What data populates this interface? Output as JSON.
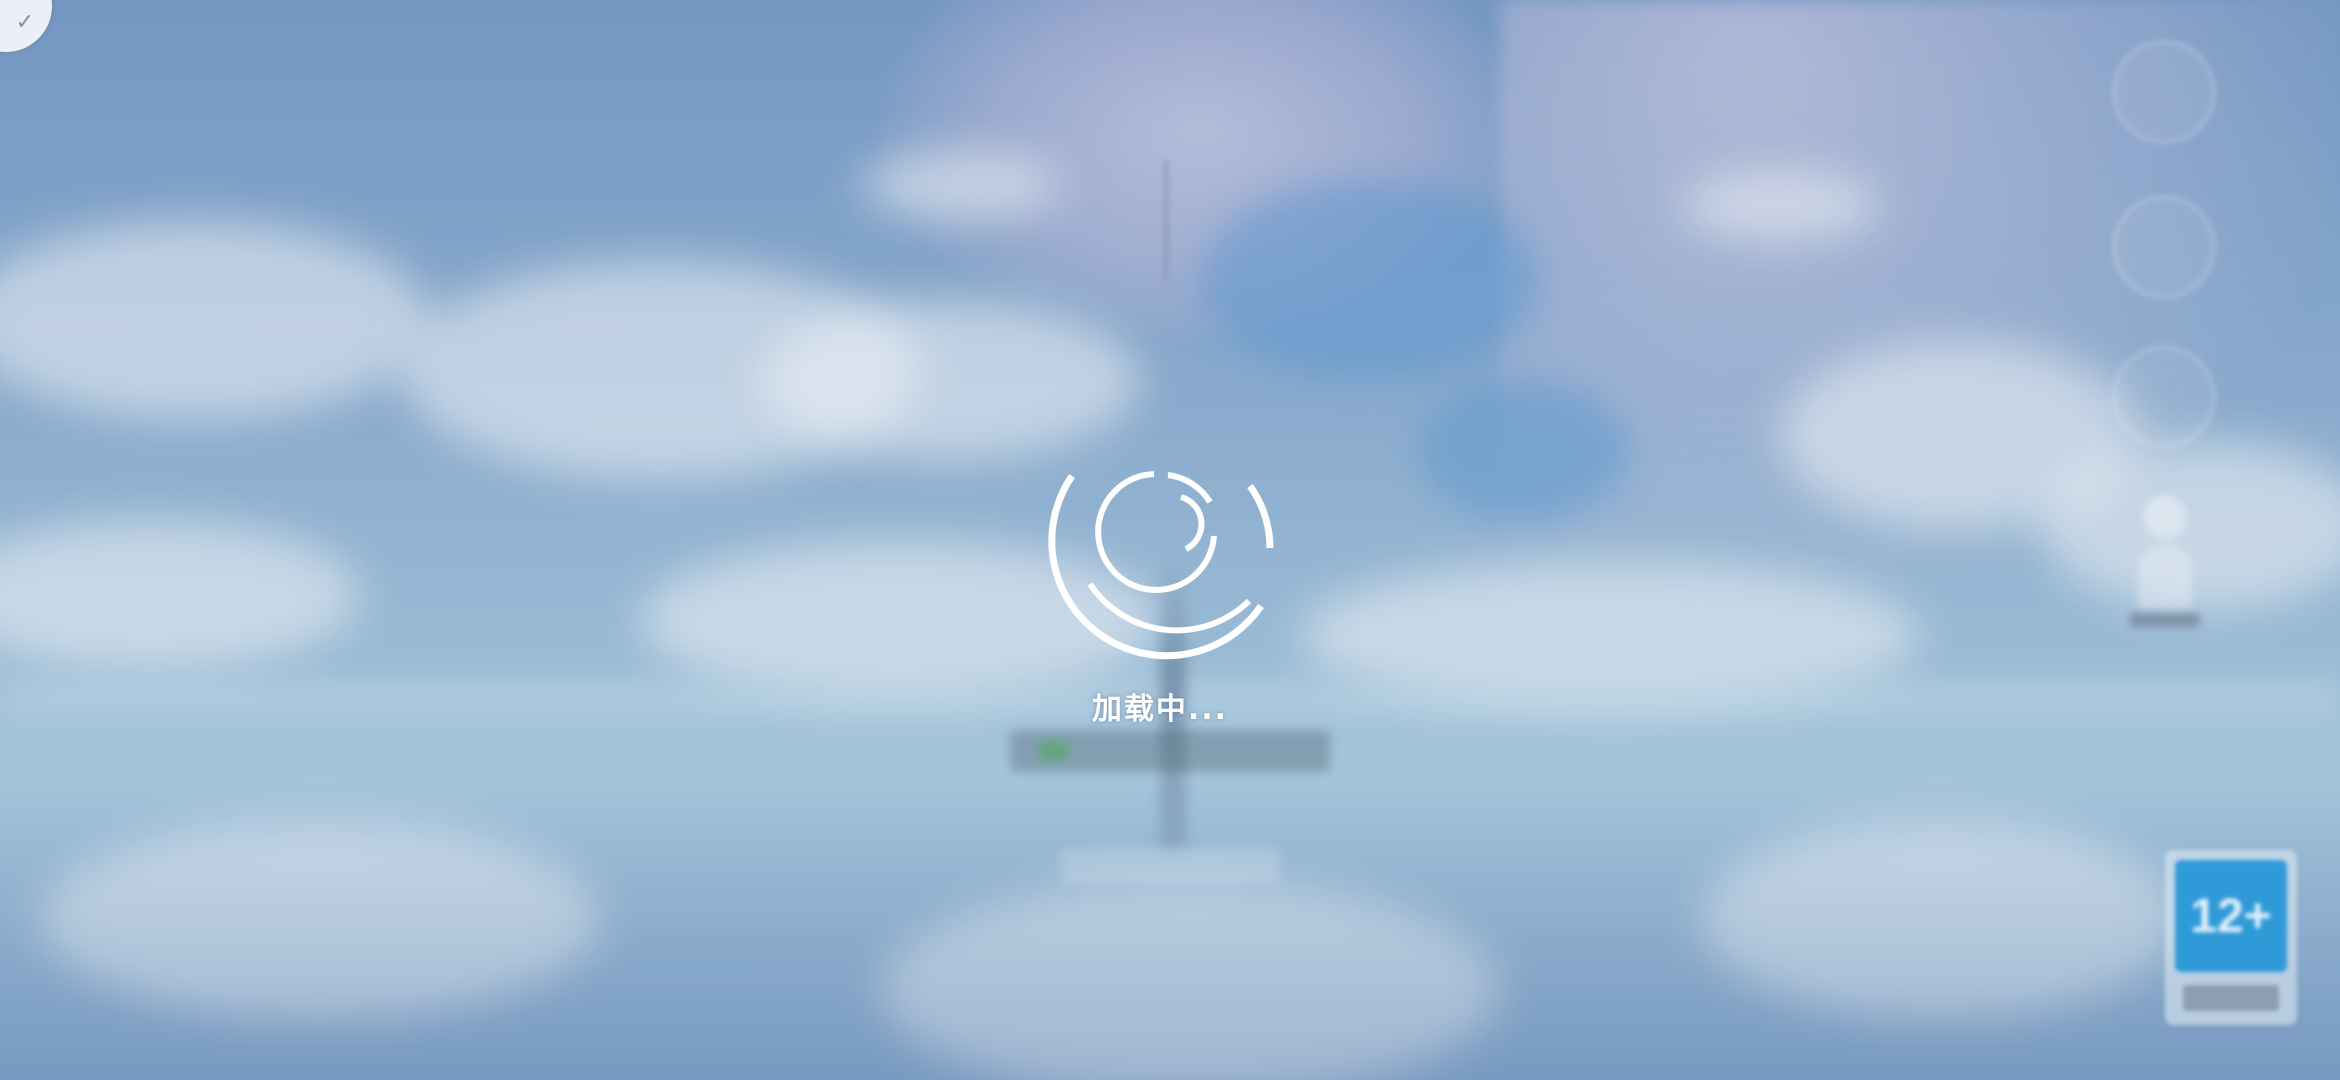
{
  "loading": {
    "text": "加载中..."
  },
  "age_rating": {
    "label": "12+"
  },
  "icons": {
    "loader": "loading-spinner-icon",
    "corner": "clear-icon"
  },
  "colors": {
    "sky_top": "#6f95c2",
    "sky_mid": "#9cbfd8",
    "loader_stroke": "#ffffff",
    "badge_blue": "#2f9ad8",
    "progress_green": "#46aa50"
  }
}
